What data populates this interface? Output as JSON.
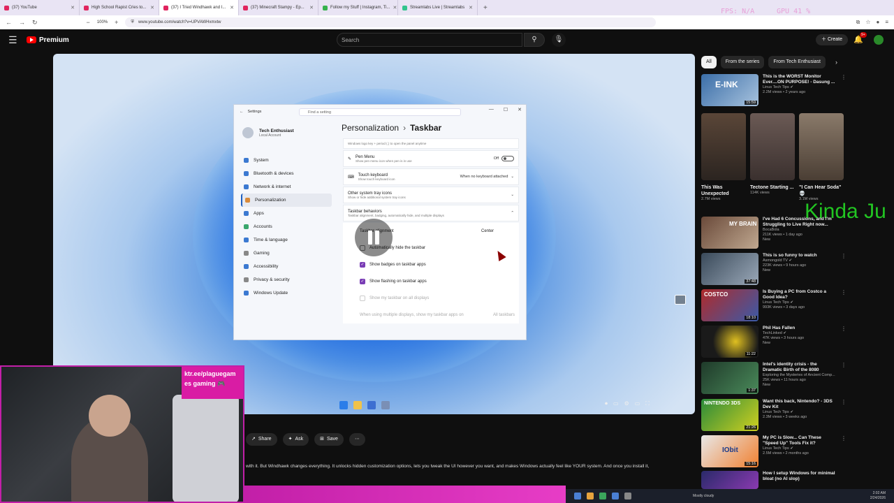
{
  "browser": {
    "tabs": [
      {
        "label": "(37) YouTube",
        "active": false
      },
      {
        "label": "High School Rapist Cries to...",
        "active": false
      },
      {
        "label": "(37) I Tried Windhawk and I...",
        "active": true
      },
      {
        "label": "(37) Minecraft Stampy - Ep...",
        "active": false
      },
      {
        "label": "Follow my Stuff | Instagram, Ti...",
        "active": false
      },
      {
        "label": "Streamlabs Live | Streamlabs",
        "active": false
      }
    ],
    "zoom": "100%",
    "url": "www.youtube.com/watch?v=UPVAWHxmxtw",
    "overlay_fps": "FPS: N/A",
    "overlay_gpu": "GPU 41 %"
  },
  "youtube": {
    "logo_text": "Premium",
    "search_placeholder": "Search",
    "create_label": "Create",
    "bell_badge": "9+"
  },
  "settings_window": {
    "title": "Settings",
    "find_placeholder": "Find a setting",
    "account_name": "Tech Enthusiast",
    "account_type": "Local Account",
    "nav": [
      {
        "label": "System",
        "selected": false
      },
      {
        "label": "Bluetooth & devices",
        "selected": false
      },
      {
        "label": "Network & internet",
        "selected": false
      },
      {
        "label": "Personalization",
        "selected": true
      },
      {
        "label": "Apps",
        "selected": false
      },
      {
        "label": "Accounts",
        "selected": false
      },
      {
        "label": "Time & language",
        "selected": false
      },
      {
        "label": "Gaming",
        "selected": false
      },
      {
        "label": "Accessibility",
        "selected": false
      },
      {
        "label": "Privacy & security",
        "selected": false
      },
      {
        "label": "Windows Update",
        "selected": false
      }
    ],
    "breadcrumb_parent": "Personalization",
    "breadcrumb_current": "Taskbar",
    "top_partial": "Windows logo key + period (.) to open the panel anytime",
    "pen_menu": {
      "label": "Pen Menu",
      "sub": "Show pen menu icon when pen is in use",
      "value": "Off"
    },
    "touch_keyboard": {
      "label": "Touch keyboard",
      "sub": "Show touch keyboard icon",
      "value": "When no keyboard attached"
    },
    "other_tray": {
      "label": "Other system tray icons",
      "sub": "Show or hide additional system tray icons"
    },
    "behaviors": {
      "label": "Taskbar behaviors",
      "sub": "Taskbar alignment, badging, automatically hide, and multiple displays"
    },
    "alignment": {
      "label": "Taskbar alignment",
      "value": "Center"
    },
    "checks": [
      {
        "label": "Automatically hide the taskbar",
        "checked": false
      },
      {
        "label": "Show badges on taskbar apps",
        "checked": true
      },
      {
        "label": "Show flashing on taskbar apps",
        "checked": true
      },
      {
        "label": "Show my taskbar on all displays",
        "checked": false
      }
    ],
    "multi_display": {
      "label": "When using multiple displays, show my taskbar apps on",
      "value": "All taskbars"
    }
  },
  "webcam": {
    "tag_line1": "ktr.ee/plaguegam",
    "tag_line2": "es gaming 🎮"
  },
  "actions": {
    "share": "Share",
    "ask": "Ask",
    "save": "Save",
    "more": "⋯"
  },
  "description": "with it. But Windhawk changes everything. It unlocks hidden customization options, lets you tweak the UI however you want, and makes Windows actually feel like YOUR system. And once you install it,",
  "sidebar": {
    "chips": [
      {
        "label": "All",
        "selected": true
      },
      {
        "label": "From the series",
        "selected": false
      },
      {
        "label": "From Tech Enthusiast",
        "selected": false
      }
    ],
    "top_rec": {
      "title": "This is the WORST Monitor Ever....ON PURPOSE! - Dasung ...",
      "channel": "Linus Tech Tips ✔",
      "stats": "2.2M views • 2 years ago",
      "duration": "15:59",
      "thumb_text": "E-INK"
    },
    "shorts": [
      {
        "title": "This Was Unexpected",
        "views": "2.7M views"
      },
      {
        "title": "Tectone Starting ...",
        "views": "114K views"
      },
      {
        "title": "\"I Can Hear Soda\" 💀",
        "views": "3.1M views"
      }
    ],
    "recs": [
      {
        "title": "I've Had 6 Concussions, and I'm Struggling to Live Right now...",
        "channel": "BocaBola",
        "stats": "211K views • 1 day ago",
        "badge": "New",
        "duration": "",
        "thumb_text": "MY BRAIN"
      },
      {
        "title": "This is so funny to watch",
        "channel": "Asmongold TV ✔",
        "stats": "223K views • 9 hours ago",
        "badge": "New",
        "duration": "37:48",
        "thumb_text": ""
      },
      {
        "title": "Is Buying a PC from Costco a Good Idea?",
        "channel": "Linus Tech Tips ✔",
        "stats": "993K views • 3 days ago",
        "badge": "",
        "duration": "18:10",
        "thumb_text": "COSTCO"
      },
      {
        "title": "Phil Has Fallen",
        "channel": "TechLinked ✔",
        "stats": "47K views • 3 hours ago",
        "badge": "New",
        "duration": "11:22",
        "thumb_text": ""
      },
      {
        "title": "Intel's identity crisis - the Dramatic Birth of the 8080",
        "channel": "Exploring the Mysteries of Ancient Comp...",
        "stats": "25K views • 11 hours ago",
        "badge": "New",
        "duration": "1:37",
        "thumb_text": ""
      },
      {
        "title": "Want this back, Nintendo? - 3DS Dev Kit",
        "channel": "Linus Tech Tips ✔",
        "stats": "2.3M views • 3 weeks ago",
        "badge": "",
        "duration": "21:26",
        "thumb_text": "NINTENDO 3DS"
      },
      {
        "title": "My PC is Slow... Can These \"Speed Up\" Tools Fix it?",
        "channel": "Linus Tech Tips ✔",
        "stats": "2.5M views • 2 months ago",
        "badge": "",
        "duration": "15:16",
        "thumb_text": "IObit"
      },
      {
        "title": "How I setup Windows for minimal bloat (no AI slop)",
        "channel": "",
        "stats": "",
        "badge": "",
        "duration": "",
        "thumb_text": ""
      }
    ],
    "overlay_text": "Kinda Ju"
  },
  "windows_taskbar": {
    "weather": "Mostly cloudy",
    "time": "2:02 AM",
    "date": "2/24/2026"
  }
}
